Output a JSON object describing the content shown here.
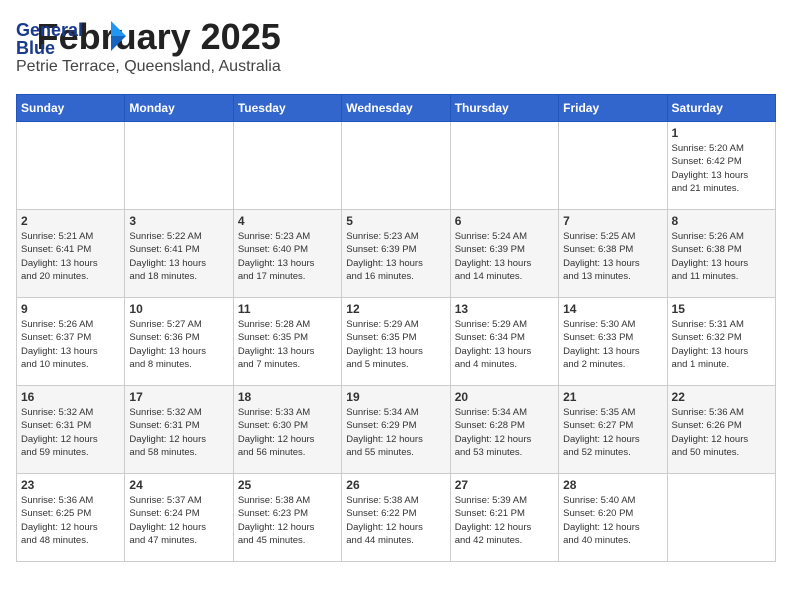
{
  "logo": {
    "line1": "General",
    "line2": "Blue"
  },
  "header": {
    "month_year": "February 2025",
    "location": "Petrie Terrace, Queensland, Australia"
  },
  "weekdays": [
    "Sunday",
    "Monday",
    "Tuesday",
    "Wednesday",
    "Thursday",
    "Friday",
    "Saturday"
  ],
  "weeks": [
    [
      {
        "day": "",
        "info": ""
      },
      {
        "day": "",
        "info": ""
      },
      {
        "day": "",
        "info": ""
      },
      {
        "day": "",
        "info": ""
      },
      {
        "day": "",
        "info": ""
      },
      {
        "day": "",
        "info": ""
      },
      {
        "day": "1",
        "info": "Sunrise: 5:20 AM\nSunset: 6:42 PM\nDaylight: 13 hours\nand 21 minutes."
      }
    ],
    [
      {
        "day": "2",
        "info": "Sunrise: 5:21 AM\nSunset: 6:41 PM\nDaylight: 13 hours\nand 20 minutes."
      },
      {
        "day": "3",
        "info": "Sunrise: 5:22 AM\nSunset: 6:41 PM\nDaylight: 13 hours\nand 18 minutes."
      },
      {
        "day": "4",
        "info": "Sunrise: 5:23 AM\nSunset: 6:40 PM\nDaylight: 13 hours\nand 17 minutes."
      },
      {
        "day": "5",
        "info": "Sunrise: 5:23 AM\nSunset: 6:39 PM\nDaylight: 13 hours\nand 16 minutes."
      },
      {
        "day": "6",
        "info": "Sunrise: 5:24 AM\nSunset: 6:39 PM\nDaylight: 13 hours\nand 14 minutes."
      },
      {
        "day": "7",
        "info": "Sunrise: 5:25 AM\nSunset: 6:38 PM\nDaylight: 13 hours\nand 13 minutes."
      },
      {
        "day": "8",
        "info": "Sunrise: 5:26 AM\nSunset: 6:38 PM\nDaylight: 13 hours\nand 11 minutes."
      }
    ],
    [
      {
        "day": "9",
        "info": "Sunrise: 5:26 AM\nSunset: 6:37 PM\nDaylight: 13 hours\nand 10 minutes."
      },
      {
        "day": "10",
        "info": "Sunrise: 5:27 AM\nSunset: 6:36 PM\nDaylight: 13 hours\nand 8 minutes."
      },
      {
        "day": "11",
        "info": "Sunrise: 5:28 AM\nSunset: 6:35 PM\nDaylight: 13 hours\nand 7 minutes."
      },
      {
        "day": "12",
        "info": "Sunrise: 5:29 AM\nSunset: 6:35 PM\nDaylight: 13 hours\nand 5 minutes."
      },
      {
        "day": "13",
        "info": "Sunrise: 5:29 AM\nSunset: 6:34 PM\nDaylight: 13 hours\nand 4 minutes."
      },
      {
        "day": "14",
        "info": "Sunrise: 5:30 AM\nSunset: 6:33 PM\nDaylight: 13 hours\nand 2 minutes."
      },
      {
        "day": "15",
        "info": "Sunrise: 5:31 AM\nSunset: 6:32 PM\nDaylight: 13 hours\nand 1 minute."
      }
    ],
    [
      {
        "day": "16",
        "info": "Sunrise: 5:32 AM\nSunset: 6:31 PM\nDaylight: 12 hours\nand 59 minutes."
      },
      {
        "day": "17",
        "info": "Sunrise: 5:32 AM\nSunset: 6:31 PM\nDaylight: 12 hours\nand 58 minutes."
      },
      {
        "day": "18",
        "info": "Sunrise: 5:33 AM\nSunset: 6:30 PM\nDaylight: 12 hours\nand 56 minutes."
      },
      {
        "day": "19",
        "info": "Sunrise: 5:34 AM\nSunset: 6:29 PM\nDaylight: 12 hours\nand 55 minutes."
      },
      {
        "day": "20",
        "info": "Sunrise: 5:34 AM\nSunset: 6:28 PM\nDaylight: 12 hours\nand 53 minutes."
      },
      {
        "day": "21",
        "info": "Sunrise: 5:35 AM\nSunset: 6:27 PM\nDaylight: 12 hours\nand 52 minutes."
      },
      {
        "day": "22",
        "info": "Sunrise: 5:36 AM\nSunset: 6:26 PM\nDaylight: 12 hours\nand 50 minutes."
      }
    ],
    [
      {
        "day": "23",
        "info": "Sunrise: 5:36 AM\nSunset: 6:25 PM\nDaylight: 12 hours\nand 48 minutes."
      },
      {
        "day": "24",
        "info": "Sunrise: 5:37 AM\nSunset: 6:24 PM\nDaylight: 12 hours\nand 47 minutes."
      },
      {
        "day": "25",
        "info": "Sunrise: 5:38 AM\nSunset: 6:23 PM\nDaylight: 12 hours\nand 45 minutes."
      },
      {
        "day": "26",
        "info": "Sunrise: 5:38 AM\nSunset: 6:22 PM\nDaylight: 12 hours\nand 44 minutes."
      },
      {
        "day": "27",
        "info": "Sunrise: 5:39 AM\nSunset: 6:21 PM\nDaylight: 12 hours\nand 42 minutes."
      },
      {
        "day": "28",
        "info": "Sunrise: 5:40 AM\nSunset: 6:20 PM\nDaylight: 12 hours\nand 40 minutes."
      },
      {
        "day": "",
        "info": ""
      }
    ]
  ]
}
